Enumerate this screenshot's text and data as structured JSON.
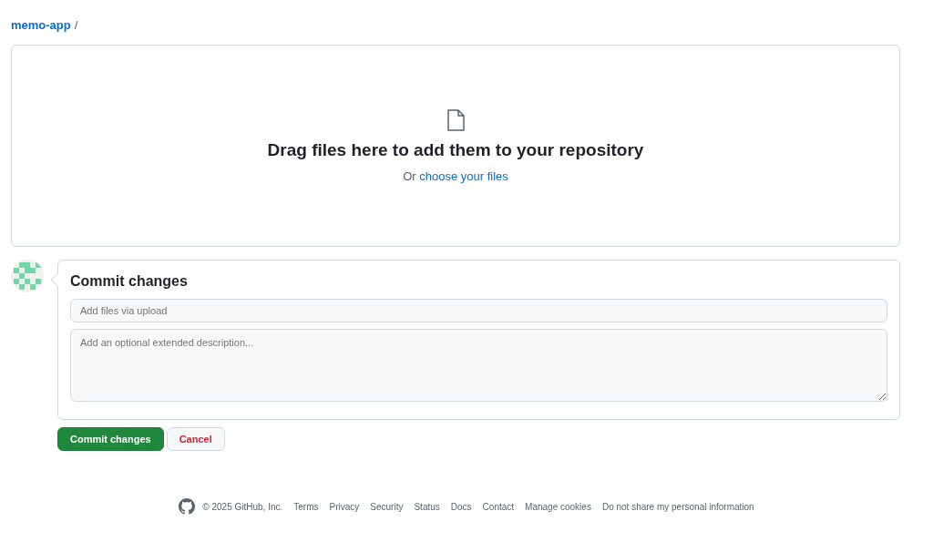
{
  "breadcrumb": {
    "repo": "memo-app",
    "separator": "/"
  },
  "dropzone": {
    "title": "Drag files here to add them to your repository",
    "prefix": "Or",
    "link": "choose your files"
  },
  "commit": {
    "title": "Commit changes",
    "summary": {
      "placeholder": "Add files via upload"
    },
    "description": {
      "placeholder": "Add an optional extended description..."
    }
  },
  "buttons": [
    {
      "label": "Commit changes",
      "kind": "primary"
    },
    {
      "label": "Cancel",
      "kind": "danger"
    }
  ],
  "footer": {
    "copyright": "© 2025 GitHub, Inc.",
    "links": [
      "Terms",
      "Privacy",
      "Security",
      "Status",
      "Docs",
      "Contact",
      "Manage cookies",
      "Do not share my personal information"
    ]
  }
}
